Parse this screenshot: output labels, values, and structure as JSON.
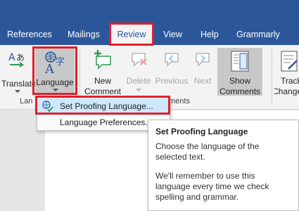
{
  "tabs": [
    "References",
    "Mailings",
    "Review",
    "View",
    "Help",
    "Grammarly"
  ],
  "active_tab": "Review",
  "ribbon": {
    "translate_label": "Translate",
    "language_label": "Language",
    "new_comment_line1": "New",
    "new_comment_line2": "Comment",
    "delete_label": "Delete",
    "previous_label": "Previous",
    "next_label": "Next",
    "show_comments_line1": "Show",
    "show_comments_line2": "Comments",
    "track_line1": "Track",
    "track_line2": "Change",
    "group_language_partial": "Lan",
    "group_comments_partial": "ments"
  },
  "language_menu": {
    "set_proofing": "Set Proofing Language...",
    "preferences": "Language Preferences..."
  },
  "tooltip": {
    "title": "Set Proofing Language",
    "desc": "Choose the language of the selected text.",
    "note": "We'll remember to use this language every time we check spelling and grammar."
  },
  "colors": {
    "brand_blue": "#2b579a",
    "highlight_red": "#e0202a",
    "menu_hover": "#cde8fb",
    "button_pressed": "#c8c8c8"
  }
}
